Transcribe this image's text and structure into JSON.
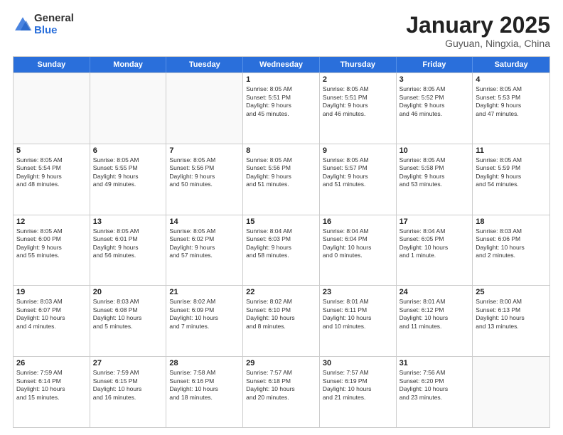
{
  "logo": {
    "general": "General",
    "blue": "Blue"
  },
  "title": "January 2025",
  "subtitle": "Guyuan, Ningxia, China",
  "days": [
    "Sunday",
    "Monday",
    "Tuesday",
    "Wednesday",
    "Thursday",
    "Friday",
    "Saturday"
  ],
  "weeks": [
    [
      {
        "day": "",
        "lines": []
      },
      {
        "day": "",
        "lines": []
      },
      {
        "day": "",
        "lines": []
      },
      {
        "day": "1",
        "lines": [
          "Sunrise: 8:05 AM",
          "Sunset: 5:51 PM",
          "Daylight: 9 hours",
          "and 45 minutes."
        ]
      },
      {
        "day": "2",
        "lines": [
          "Sunrise: 8:05 AM",
          "Sunset: 5:51 PM",
          "Daylight: 9 hours",
          "and 46 minutes."
        ]
      },
      {
        "day": "3",
        "lines": [
          "Sunrise: 8:05 AM",
          "Sunset: 5:52 PM",
          "Daylight: 9 hours",
          "and 46 minutes."
        ]
      },
      {
        "day": "4",
        "lines": [
          "Sunrise: 8:05 AM",
          "Sunset: 5:53 PM",
          "Daylight: 9 hours",
          "and 47 minutes."
        ]
      }
    ],
    [
      {
        "day": "5",
        "lines": [
          "Sunrise: 8:05 AM",
          "Sunset: 5:54 PM",
          "Daylight: 9 hours",
          "and 48 minutes."
        ]
      },
      {
        "day": "6",
        "lines": [
          "Sunrise: 8:05 AM",
          "Sunset: 5:55 PM",
          "Daylight: 9 hours",
          "and 49 minutes."
        ]
      },
      {
        "day": "7",
        "lines": [
          "Sunrise: 8:05 AM",
          "Sunset: 5:56 PM",
          "Daylight: 9 hours",
          "and 50 minutes."
        ]
      },
      {
        "day": "8",
        "lines": [
          "Sunrise: 8:05 AM",
          "Sunset: 5:56 PM",
          "Daylight: 9 hours",
          "and 51 minutes."
        ]
      },
      {
        "day": "9",
        "lines": [
          "Sunrise: 8:05 AM",
          "Sunset: 5:57 PM",
          "Daylight: 9 hours",
          "and 51 minutes."
        ]
      },
      {
        "day": "10",
        "lines": [
          "Sunrise: 8:05 AM",
          "Sunset: 5:58 PM",
          "Daylight: 9 hours",
          "and 53 minutes."
        ]
      },
      {
        "day": "11",
        "lines": [
          "Sunrise: 8:05 AM",
          "Sunset: 5:59 PM",
          "Daylight: 9 hours",
          "and 54 minutes."
        ]
      }
    ],
    [
      {
        "day": "12",
        "lines": [
          "Sunrise: 8:05 AM",
          "Sunset: 6:00 PM",
          "Daylight: 9 hours",
          "and 55 minutes."
        ]
      },
      {
        "day": "13",
        "lines": [
          "Sunrise: 8:05 AM",
          "Sunset: 6:01 PM",
          "Daylight: 9 hours",
          "and 56 minutes."
        ]
      },
      {
        "day": "14",
        "lines": [
          "Sunrise: 8:05 AM",
          "Sunset: 6:02 PM",
          "Daylight: 9 hours",
          "and 57 minutes."
        ]
      },
      {
        "day": "15",
        "lines": [
          "Sunrise: 8:04 AM",
          "Sunset: 6:03 PM",
          "Daylight: 9 hours",
          "and 58 minutes."
        ]
      },
      {
        "day": "16",
        "lines": [
          "Sunrise: 8:04 AM",
          "Sunset: 6:04 PM",
          "Daylight: 10 hours",
          "and 0 minutes."
        ]
      },
      {
        "day": "17",
        "lines": [
          "Sunrise: 8:04 AM",
          "Sunset: 6:05 PM",
          "Daylight: 10 hours",
          "and 1 minute."
        ]
      },
      {
        "day": "18",
        "lines": [
          "Sunrise: 8:03 AM",
          "Sunset: 6:06 PM",
          "Daylight: 10 hours",
          "and 2 minutes."
        ]
      }
    ],
    [
      {
        "day": "19",
        "lines": [
          "Sunrise: 8:03 AM",
          "Sunset: 6:07 PM",
          "Daylight: 10 hours",
          "and 4 minutes."
        ]
      },
      {
        "day": "20",
        "lines": [
          "Sunrise: 8:03 AM",
          "Sunset: 6:08 PM",
          "Daylight: 10 hours",
          "and 5 minutes."
        ]
      },
      {
        "day": "21",
        "lines": [
          "Sunrise: 8:02 AM",
          "Sunset: 6:09 PM",
          "Daylight: 10 hours",
          "and 7 minutes."
        ]
      },
      {
        "day": "22",
        "lines": [
          "Sunrise: 8:02 AM",
          "Sunset: 6:10 PM",
          "Daylight: 10 hours",
          "and 8 minutes."
        ]
      },
      {
        "day": "23",
        "lines": [
          "Sunrise: 8:01 AM",
          "Sunset: 6:11 PM",
          "Daylight: 10 hours",
          "and 10 minutes."
        ]
      },
      {
        "day": "24",
        "lines": [
          "Sunrise: 8:01 AM",
          "Sunset: 6:12 PM",
          "Daylight: 10 hours",
          "and 11 minutes."
        ]
      },
      {
        "day": "25",
        "lines": [
          "Sunrise: 8:00 AM",
          "Sunset: 6:13 PM",
          "Daylight: 10 hours",
          "and 13 minutes."
        ]
      }
    ],
    [
      {
        "day": "26",
        "lines": [
          "Sunrise: 7:59 AM",
          "Sunset: 6:14 PM",
          "Daylight: 10 hours",
          "and 15 minutes."
        ]
      },
      {
        "day": "27",
        "lines": [
          "Sunrise: 7:59 AM",
          "Sunset: 6:15 PM",
          "Daylight: 10 hours",
          "and 16 minutes."
        ]
      },
      {
        "day": "28",
        "lines": [
          "Sunrise: 7:58 AM",
          "Sunset: 6:16 PM",
          "Daylight: 10 hours",
          "and 18 minutes."
        ]
      },
      {
        "day": "29",
        "lines": [
          "Sunrise: 7:57 AM",
          "Sunset: 6:18 PM",
          "Daylight: 10 hours",
          "and 20 minutes."
        ]
      },
      {
        "day": "30",
        "lines": [
          "Sunrise: 7:57 AM",
          "Sunset: 6:19 PM",
          "Daylight: 10 hours",
          "and 21 minutes."
        ]
      },
      {
        "day": "31",
        "lines": [
          "Sunrise: 7:56 AM",
          "Sunset: 6:20 PM",
          "Daylight: 10 hours",
          "and 23 minutes."
        ]
      },
      {
        "day": "",
        "lines": []
      }
    ]
  ]
}
